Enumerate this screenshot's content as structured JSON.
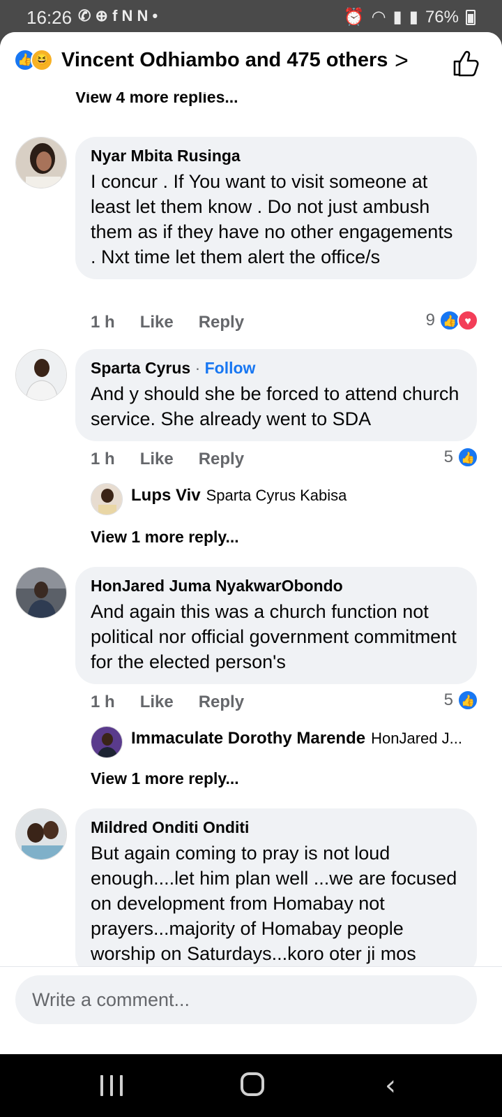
{
  "status_bar": {
    "time": "16:26",
    "left_icons": [
      "whatsapp-icon",
      "app-icon",
      "facebook-icon",
      "news-icon",
      "news-icon"
    ],
    "left_glyphs": "✆ ⊕ f N N •",
    "battery": "76%"
  },
  "header": {
    "reaction_icons": [
      "like-icon",
      "haha-icon"
    ],
    "title": "Vincent Odhiambo and 475 others"
  },
  "view_more_top": "View 4 more replies...",
  "comments": [
    {
      "name": "Nyar Mbita Rusinga",
      "text": "I concur . If You want to visit someone at least let them know . Do not just ambush them as if they have no other engagements . Nxt time let them alert the office/s",
      "time": "1 h",
      "like": "Like",
      "reply": "Reply",
      "reaction_count": "9",
      "reactions": [
        "like-icon",
        "love-icon"
      ]
    },
    {
      "name": "Sparta Cyrus",
      "follow": "Follow",
      "separator": "·",
      "text": "And y should she be forced to attend church service. She already went to SDA",
      "time": "1 h",
      "like": "Like",
      "reply": "Reply",
      "reaction_count": "5",
      "reactions": [
        "like-icon"
      ],
      "reply_preview": {
        "name": "Lups Viv",
        "text": "Sparta Cyrus Kabisa"
      },
      "view_more": "View 1 more reply..."
    },
    {
      "name": "HonJared Juma NyakwarObondo",
      "text": "And again this was a church function not political nor official government commitment for the elected person's",
      "time": "1 h",
      "like": "Like",
      "reply": "Reply",
      "reaction_count": "5",
      "reactions": [
        "like-icon"
      ],
      "reply_preview": {
        "name": "Immaculate Dorothy Marende",
        "text": "HonJared J..."
      },
      "view_more": "View 1 more reply..."
    },
    {
      "name": "Mildred Onditi Onditi",
      "text": "But again coming to pray is not loud enough....let him plan well ...we are focused on development from Homabay not prayers...majority of Homabay people worship on Saturdays...koro oter ji mos"
    }
  ],
  "composer": {
    "placeholder": "Write a comment..."
  },
  "colors": {
    "accent": "#1877f2",
    "love": "#f33e58",
    "bubble": "#f0f2f5",
    "muted": "#65676b"
  }
}
